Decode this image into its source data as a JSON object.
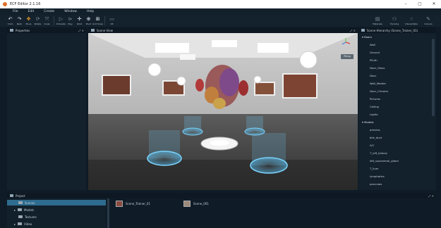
{
  "window": {
    "title": "ECF Editor 2.1.16"
  },
  "menu": [
    "File",
    "Edit",
    "Create",
    "Window",
    "Help"
  ],
  "toolbar": {
    "tools": [
      {
        "label": "Undo",
        "icon": "undo-icon",
        "glyph": "↶"
      },
      {
        "label": "Redo",
        "icon": "redo-icon",
        "glyph": "↷"
      },
      {
        "label": "Move",
        "icon": "move-icon",
        "glyph": "✥"
      },
      {
        "label": "Rotate",
        "icon": "rotate-icon",
        "glyph": "⟳"
      },
      {
        "label": "Scale",
        "icon": "scale-icon",
        "glyph": "⤧"
      },
      {
        "label": "Simulate",
        "icon": "play-icon",
        "glyph": "▷"
      },
      {
        "label": "Play",
        "icon": "play-alt-icon",
        "glyph": "⊳"
      },
      {
        "label": "Orbit",
        "icon": "orbit-icon",
        "glyph": "✢"
      },
      {
        "label": "Pivot",
        "icon": "pivot-icon",
        "glyph": "⊕"
      },
      {
        "label": "Grid Snap",
        "icon": "grid-snap-icon",
        "glyph": "⊞"
      },
      {
        "label": "VR",
        "icon": "vr-icon",
        "glyph": "▭"
      }
    ],
    "right_tools": [
      {
        "label": "Materials",
        "icon": "materials-icon",
        "glyph": "▤"
      },
      {
        "label": "Tracking",
        "icon": "tracking-icon",
        "glyph": "⚇"
      },
      {
        "label": "Interactable",
        "icon": "interactable-icon",
        "glyph": "☝"
      },
      {
        "label": "Colours",
        "icon": "colours-icon",
        "glyph": "✎"
      }
    ]
  },
  "properties": {
    "title": "Properties"
  },
  "scene_view": {
    "title": "Scene View",
    "overlay_button": "Persp"
  },
  "hierarchy": {
    "title": "Scene Hierarchy (Scene_Trainer_01)",
    "groups": [
      {
        "name": "Room",
        "children": [
          "Wall",
          "Ground",
          "Plinth",
          "Door_Glass",
          "Door",
          "Wall_Marble",
          "Door_Chrome",
          "Pictures",
          "Ceiling",
          "Lights"
        ]
      },
      {
        "name": "Models",
        "children": [
          "arteries",
          "bile_duct",
          "IVC",
          "T_left_kidney",
          "left_suprarenal_gland",
          "T_liver",
          "lymphatics",
          "pancreas"
        ]
      }
    ]
  },
  "project": {
    "title": "Project",
    "tree": [
      "Scenes",
      "Models",
      "Textures",
      "Video"
    ],
    "assets": [
      "Scene_Trainer_01",
      "Scene_001"
    ]
  },
  "colors": {
    "accent": "#2e6c8f",
    "panel": "#13212d",
    "background": "#0f1c27"
  }
}
